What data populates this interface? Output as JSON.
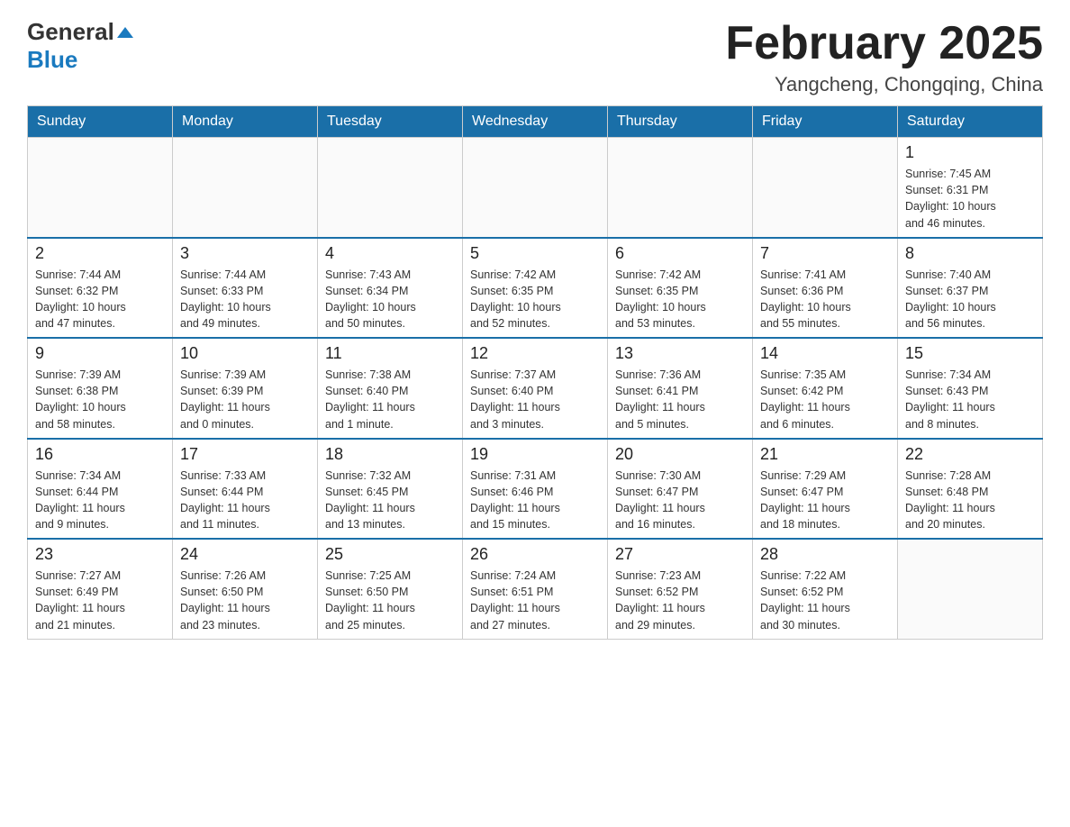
{
  "logo": {
    "general": "General",
    "arrow": "▲",
    "blue": "Blue"
  },
  "title": "February 2025",
  "location": "Yangcheng, Chongqing, China",
  "weekdays": [
    "Sunday",
    "Monday",
    "Tuesday",
    "Wednesday",
    "Thursday",
    "Friday",
    "Saturday"
  ],
  "weeks": [
    [
      {
        "day": "",
        "info": ""
      },
      {
        "day": "",
        "info": ""
      },
      {
        "day": "",
        "info": ""
      },
      {
        "day": "",
        "info": ""
      },
      {
        "day": "",
        "info": ""
      },
      {
        "day": "",
        "info": ""
      },
      {
        "day": "1",
        "info": "Sunrise: 7:45 AM\nSunset: 6:31 PM\nDaylight: 10 hours\nand 46 minutes."
      }
    ],
    [
      {
        "day": "2",
        "info": "Sunrise: 7:44 AM\nSunset: 6:32 PM\nDaylight: 10 hours\nand 47 minutes."
      },
      {
        "day": "3",
        "info": "Sunrise: 7:44 AM\nSunset: 6:33 PM\nDaylight: 10 hours\nand 49 minutes."
      },
      {
        "day": "4",
        "info": "Sunrise: 7:43 AM\nSunset: 6:34 PM\nDaylight: 10 hours\nand 50 minutes."
      },
      {
        "day": "5",
        "info": "Sunrise: 7:42 AM\nSunset: 6:35 PM\nDaylight: 10 hours\nand 52 minutes."
      },
      {
        "day": "6",
        "info": "Sunrise: 7:42 AM\nSunset: 6:35 PM\nDaylight: 10 hours\nand 53 minutes."
      },
      {
        "day": "7",
        "info": "Sunrise: 7:41 AM\nSunset: 6:36 PM\nDaylight: 10 hours\nand 55 minutes."
      },
      {
        "day": "8",
        "info": "Sunrise: 7:40 AM\nSunset: 6:37 PM\nDaylight: 10 hours\nand 56 minutes."
      }
    ],
    [
      {
        "day": "9",
        "info": "Sunrise: 7:39 AM\nSunset: 6:38 PM\nDaylight: 10 hours\nand 58 minutes."
      },
      {
        "day": "10",
        "info": "Sunrise: 7:39 AM\nSunset: 6:39 PM\nDaylight: 11 hours\nand 0 minutes."
      },
      {
        "day": "11",
        "info": "Sunrise: 7:38 AM\nSunset: 6:40 PM\nDaylight: 11 hours\nand 1 minute."
      },
      {
        "day": "12",
        "info": "Sunrise: 7:37 AM\nSunset: 6:40 PM\nDaylight: 11 hours\nand 3 minutes."
      },
      {
        "day": "13",
        "info": "Sunrise: 7:36 AM\nSunset: 6:41 PM\nDaylight: 11 hours\nand 5 minutes."
      },
      {
        "day": "14",
        "info": "Sunrise: 7:35 AM\nSunset: 6:42 PM\nDaylight: 11 hours\nand 6 minutes."
      },
      {
        "day": "15",
        "info": "Sunrise: 7:34 AM\nSunset: 6:43 PM\nDaylight: 11 hours\nand 8 minutes."
      }
    ],
    [
      {
        "day": "16",
        "info": "Sunrise: 7:34 AM\nSunset: 6:44 PM\nDaylight: 11 hours\nand 9 minutes."
      },
      {
        "day": "17",
        "info": "Sunrise: 7:33 AM\nSunset: 6:44 PM\nDaylight: 11 hours\nand 11 minutes."
      },
      {
        "day": "18",
        "info": "Sunrise: 7:32 AM\nSunset: 6:45 PM\nDaylight: 11 hours\nand 13 minutes."
      },
      {
        "day": "19",
        "info": "Sunrise: 7:31 AM\nSunset: 6:46 PM\nDaylight: 11 hours\nand 15 minutes."
      },
      {
        "day": "20",
        "info": "Sunrise: 7:30 AM\nSunset: 6:47 PM\nDaylight: 11 hours\nand 16 minutes."
      },
      {
        "day": "21",
        "info": "Sunrise: 7:29 AM\nSunset: 6:47 PM\nDaylight: 11 hours\nand 18 minutes."
      },
      {
        "day": "22",
        "info": "Sunrise: 7:28 AM\nSunset: 6:48 PM\nDaylight: 11 hours\nand 20 minutes."
      }
    ],
    [
      {
        "day": "23",
        "info": "Sunrise: 7:27 AM\nSunset: 6:49 PM\nDaylight: 11 hours\nand 21 minutes."
      },
      {
        "day": "24",
        "info": "Sunrise: 7:26 AM\nSunset: 6:50 PM\nDaylight: 11 hours\nand 23 minutes."
      },
      {
        "day": "25",
        "info": "Sunrise: 7:25 AM\nSunset: 6:50 PM\nDaylight: 11 hours\nand 25 minutes."
      },
      {
        "day": "26",
        "info": "Sunrise: 7:24 AM\nSunset: 6:51 PM\nDaylight: 11 hours\nand 27 minutes."
      },
      {
        "day": "27",
        "info": "Sunrise: 7:23 AM\nSunset: 6:52 PM\nDaylight: 11 hours\nand 29 minutes."
      },
      {
        "day": "28",
        "info": "Sunrise: 7:22 AM\nSunset: 6:52 PM\nDaylight: 11 hours\nand 30 minutes."
      },
      {
        "day": "",
        "info": ""
      }
    ]
  ]
}
